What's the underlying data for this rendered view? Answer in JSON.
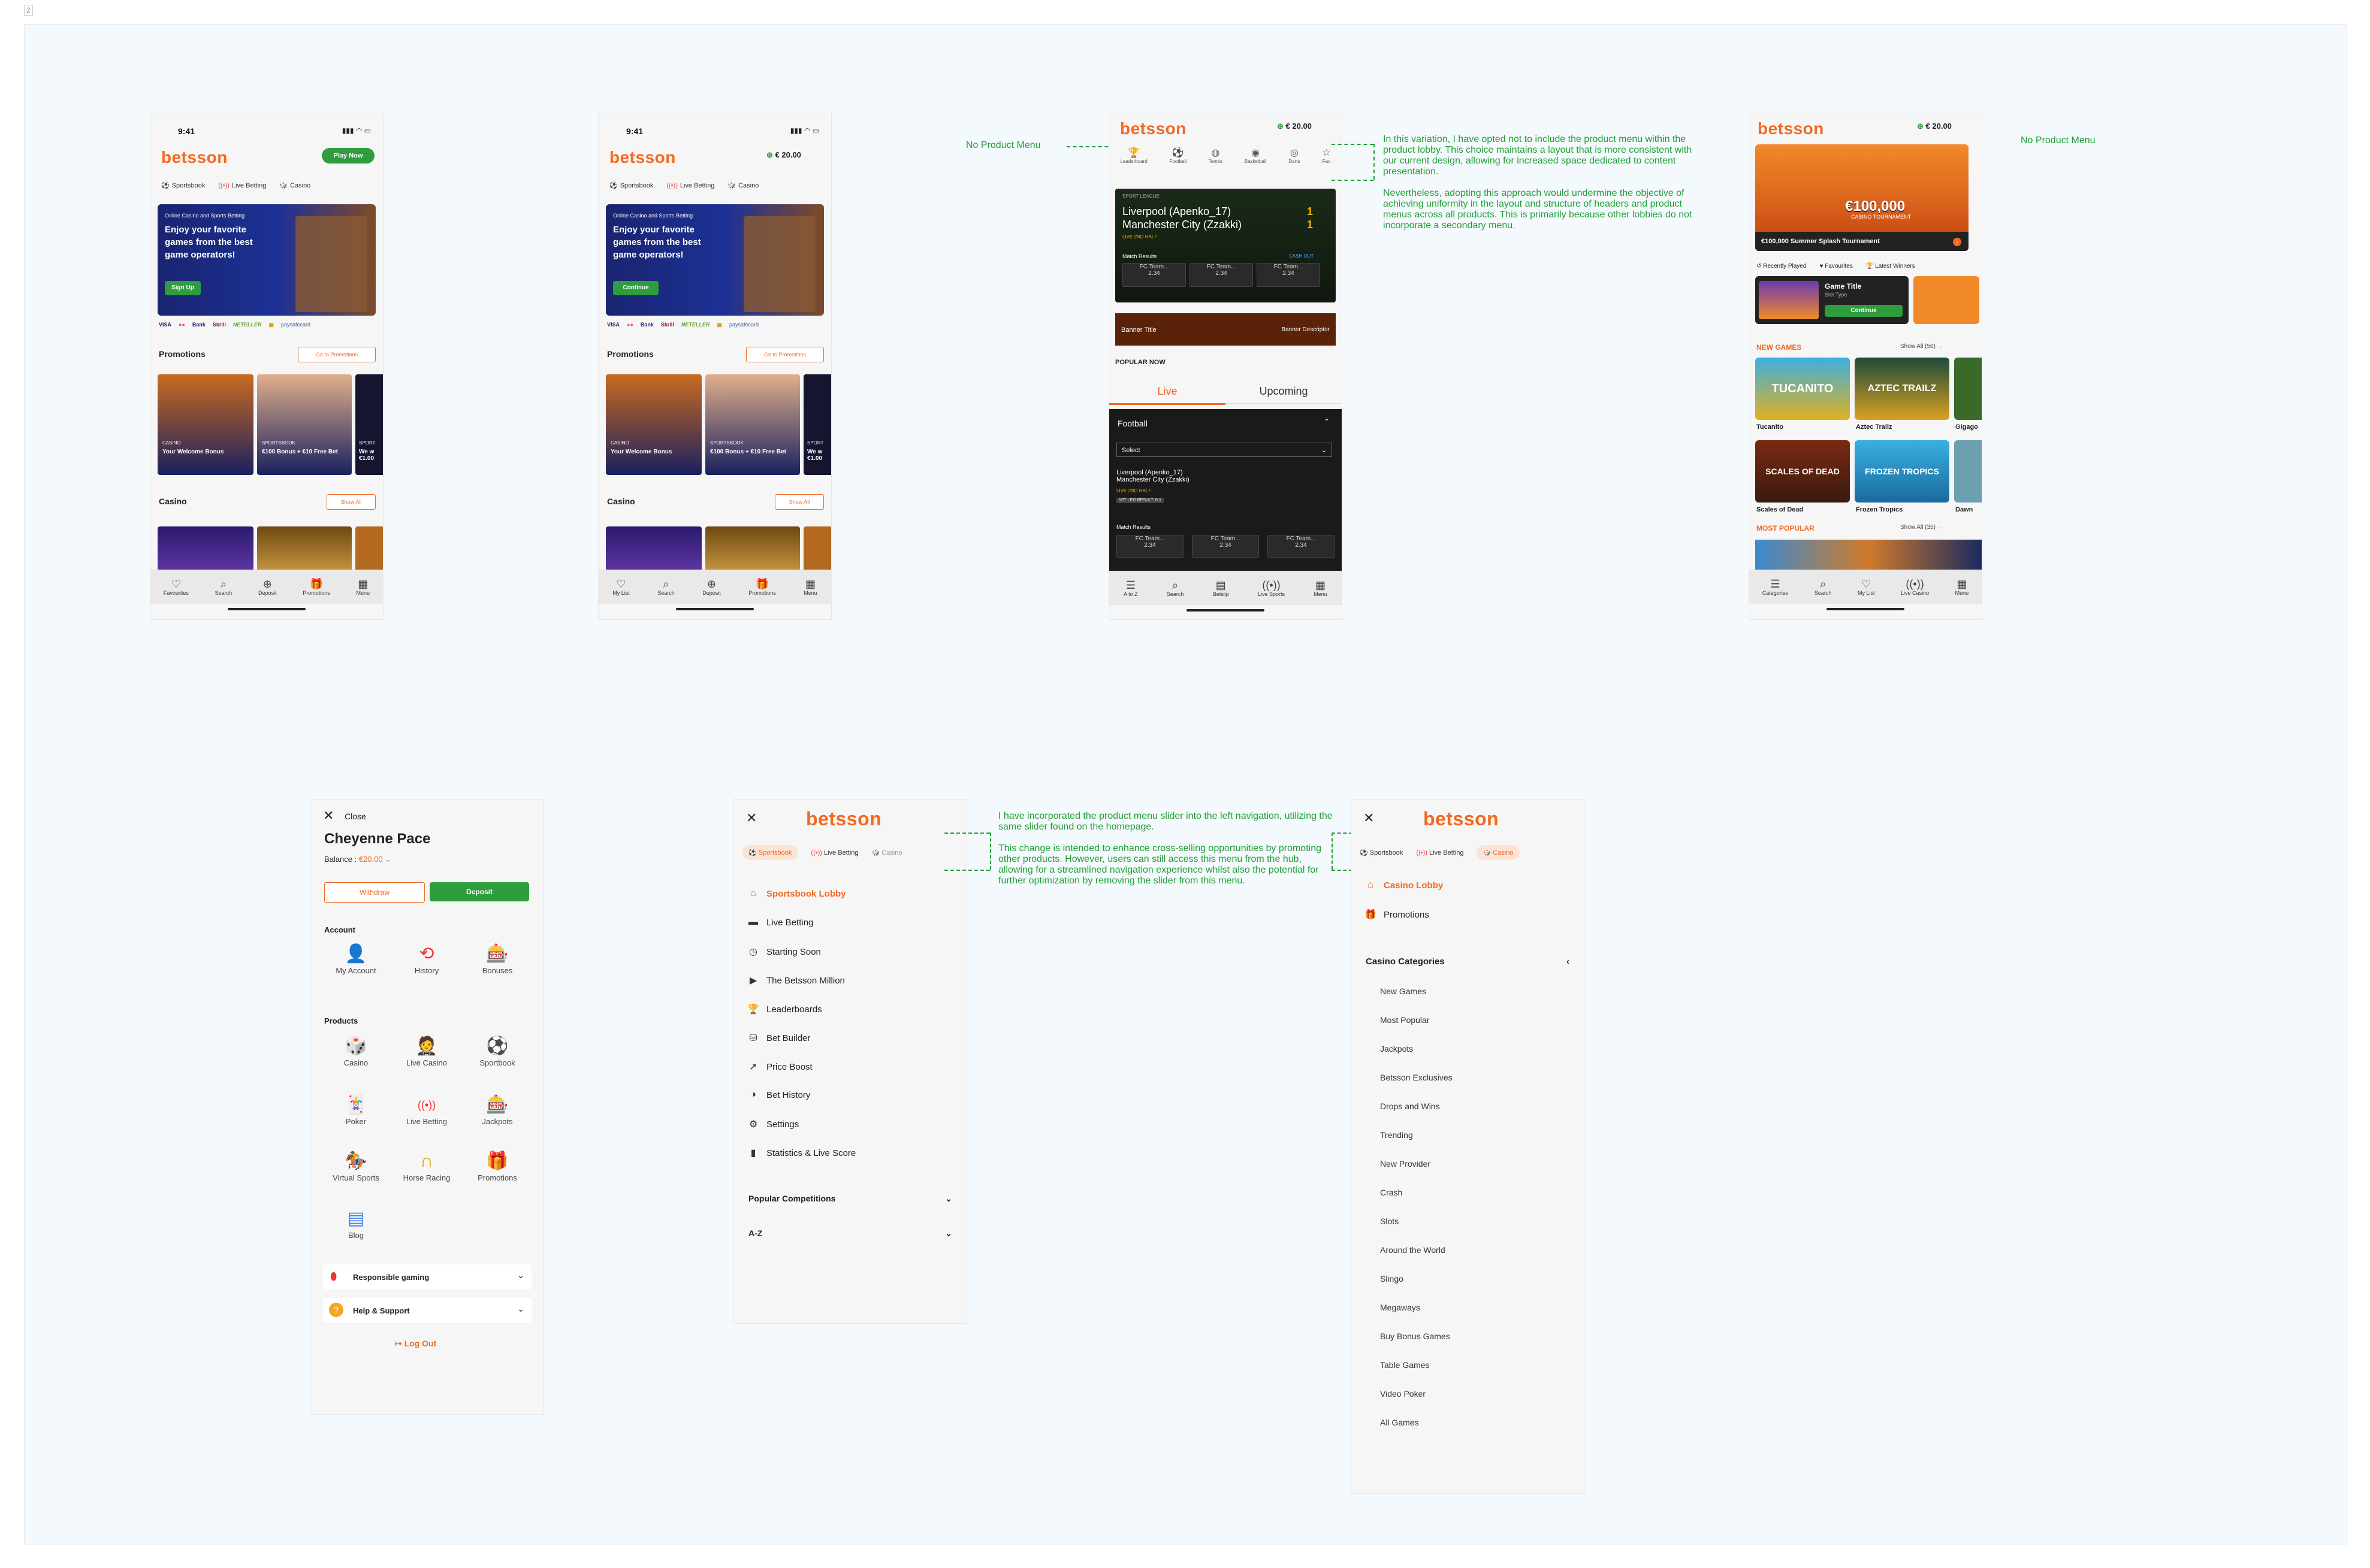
{
  "frame_tag": "2",
  "notes": {
    "no_product_menu_1": "No Product Menu",
    "no_product_menu_2": "No Product Menu",
    "variation_p1": "In this variation, I have opted not to include the product menu within the product lobby. This choice maintains a layout that is more consistent with our current design, allowing for increased space dedicated to content presentation.",
    "variation_p2": "Nevertheless, adopting this approach would undermine the objective of achieving uniformity in the layout and structure of headers and product menus across all products. This is primarily because other lobbies do not incorporate a secondary menu.",
    "slider_p1": "I have incorporated the product menu slider into the left navigation, utilizing the same slider found on the homepage.",
    "slider_p2": "This change is intended to enhance cross-selling opportunities by promoting other products. However, users can still access this menu from the hub, allowing for a streamlined navigation experience whilst also the potential for further optimization by removing the slider from this menu."
  },
  "phone1": {
    "time": "9:41",
    "logo": "betsson",
    "cta": "Play Now",
    "tabs": [
      "Sportsbook",
      "Live Betting",
      "Casino"
    ],
    "hero_kicker": "Online Casino and Sports Betting",
    "hero_title": "Enjoy your favorite games from the best game operators!",
    "hero_button": "Sign Up",
    "payments": [
      "VISA",
      "●●",
      "Bank",
      "Skrill",
      "NETELLER",
      "▣",
      "paysafecard"
    ],
    "promotions_title": "Promotions",
    "promotions_link": "Go to Promotions",
    "promo_cards": [
      {
        "kicker": "CASINO",
        "title": "Your Welcome Bonus"
      },
      {
        "kicker": "SPORTSBOOK",
        "title": "€100 Bonus + €10 Free Bet"
      },
      {
        "kicker": "SPORT",
        "title": "We w €1.00"
      }
    ],
    "casino_title": "Casino",
    "casino_link": "Show All",
    "nav": [
      "Favourites",
      "Search",
      "Deposit",
      "Promotions",
      "Menu"
    ]
  },
  "phone2": {
    "time": "9:41",
    "logo": "betsson",
    "balance": "€ 20.00",
    "tabs": [
      "Sportsbook",
      "Live Betting",
      "Casino"
    ],
    "hero_kicker": "Online Casino and Sports Betting",
    "hero_title": "Enjoy your favorite games from the best game operators!",
    "hero_button": "Continue",
    "payments": [
      "VISA",
      "●●",
      "Bank",
      "Skrill",
      "NETELLER",
      "▣",
      "paysafecard"
    ],
    "promotions_title": "Promotions",
    "promotions_link": "Go to Promotions",
    "promo_cards": [
      {
        "kicker": "CASINO",
        "title": "Your Welcome Bonus"
      },
      {
        "kicker": "SPORTSBOOK",
        "title": "€100 Bonus + €10 Free Bet"
      },
      {
        "kicker": "SPORT",
        "title": "We w €1.00"
      }
    ],
    "casino_title": "Casino",
    "casino_link": "Show All",
    "nav": [
      "My List",
      "Search",
      "Deposit",
      "Promotions",
      "Menu"
    ]
  },
  "phone3": {
    "logo": "betsson",
    "balance": "€ 20.00",
    "sport_tabs": [
      "Leaderboard",
      "Football",
      "Tennis",
      "Basketball",
      "Darts",
      "Fav"
    ],
    "league": "SPORT LEAGUE",
    "team1": "Liverpool (Apenko_17)",
    "team2": "Manchester City (Zzakki)",
    "score1": "1",
    "score2": "1",
    "live": "LIVE 2ND HALF",
    "match_results": "Match Results",
    "cash_out": "CASH OUT",
    "odds": [
      {
        "team": "FC Team...",
        "value": "2.34"
      },
      {
        "team": "FC Team...",
        "value": "2.34"
      },
      {
        "team": "FC Team...",
        "value": "2.34"
      }
    ],
    "banner_title": "Banner Title",
    "banner_desc": "Banner Descriptor",
    "popular_now": "POPULAR NOW",
    "tab_live": "Live",
    "tab_upcoming": "Upcoming",
    "sport_select": "Football",
    "select_placeholder": "Select",
    "mini_team1": "Liverpool (Apenko_17)",
    "mini_team2": "Manchester City (Zzakki)",
    "mini_live": "LIVE 2ND HALF",
    "mini_result": "1ST LEG RESULT: 0-1",
    "nav": [
      "A to Z",
      "Search",
      "Betslip",
      "Live Sports",
      "Menu"
    ]
  },
  "phone4": {
    "logo": "betsson",
    "balance": "€ 20.00",
    "hero_amount": "€100,000",
    "hero_sub": "CASINO TOURNAMENT",
    "hero_caption": "€100,000 Summer Splash Tournament",
    "quick_tabs": [
      "Recently Played",
      "Favourites",
      "Latest Winners"
    ],
    "game_title": "Game Title",
    "game_type": "Slot Type",
    "game_button": "Continue",
    "new_games": "NEW GAMES",
    "new_games_link": "Show All (50)",
    "games_row1": [
      "Tucanito",
      "Aztec Trailz",
      "Gigago"
    ],
    "games_row2": [
      "Scales of Dead",
      "Frozen Tropics",
      "Dawn"
    ],
    "tile_row1": [
      "TUCANITO",
      "AZTEC TRAILZ",
      ""
    ],
    "tile_row2": [
      "SCALES OF DEAD",
      "FROZEN TROPICS",
      ""
    ],
    "most_popular": "MOST POPULAR",
    "most_popular_link": "Show All (35)",
    "nav": [
      "Categories",
      "Search",
      "My List",
      "Live Casino",
      "Menu"
    ]
  },
  "menu1": {
    "close": "Close",
    "name": "Cheyenne Pace",
    "balance_label": "Balance :",
    "balance_value": "€20.00",
    "withdraw": "Withdraw",
    "deposit": "Deposit",
    "account_title": "Account",
    "account_items": [
      "My Account",
      "History",
      "Bonuses"
    ],
    "products_title": "Products",
    "products": [
      "Casino",
      "Live Casino",
      "Sportbook",
      "Poker",
      "Live Betting",
      "Jackpots",
      "Virtual Sports",
      "Horse Racing",
      "Promotions",
      "Blog"
    ],
    "responsible": "Responsible gaming",
    "help": "Help & Support",
    "logout": "Log Out"
  },
  "menu2": {
    "logo": "betsson",
    "tabs": [
      "Sportsbook",
      "Live Betting",
      "Casino"
    ],
    "items": [
      "Sportsbook Lobby",
      "Live Betting",
      "Starting Soon",
      "The Betsson Million",
      "Leaderboards",
      "Bet Builder",
      "Price Boost",
      "Bet History",
      "Settings",
      "Statistics & Live Score"
    ],
    "popular_competitions": "Popular Competitions",
    "az": "A-Z"
  },
  "menu3": {
    "logo": "betsson",
    "tabs": [
      "Sportsbook",
      "Live Betting",
      "Casino"
    ],
    "lobby": "Casino Lobby",
    "promotions": "Promotions",
    "categories_title": "Casino Categories",
    "categories": [
      "New Games",
      "Most Popular",
      "Jackpots",
      "Betsson Exclusives",
      "Drops and Wins",
      "Trending",
      "New Provider",
      "Crash",
      "Slots",
      "Around the World",
      "Slingo",
      "Megaways",
      "Buy Bonus Games",
      "Table Games",
      "Video Poker",
      "All Games"
    ]
  }
}
